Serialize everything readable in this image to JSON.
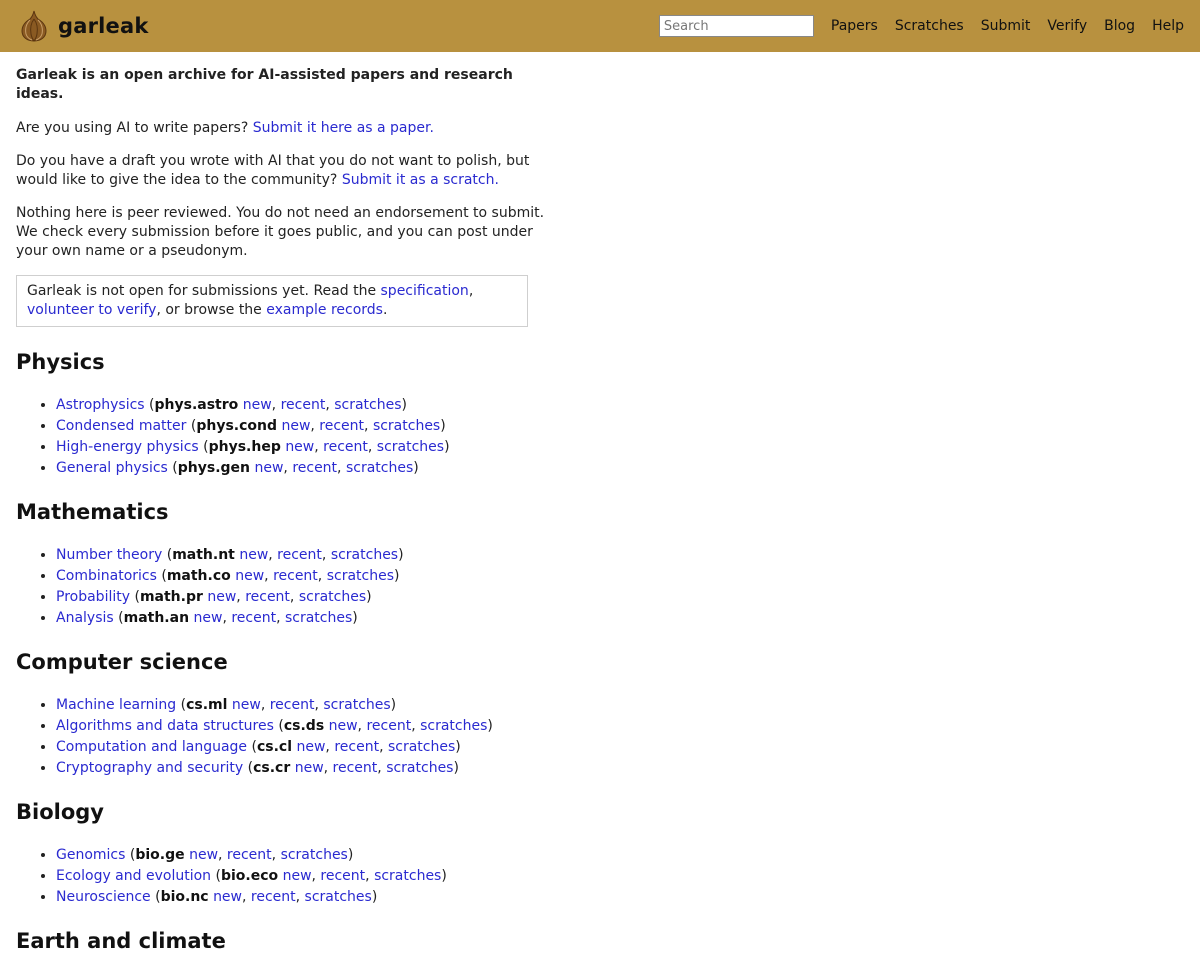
{
  "header": {
    "brand": "garleak",
    "search_placeholder": "Search",
    "nav": [
      "Papers",
      "Scratches",
      "Submit",
      "Verify",
      "Blog",
      "Help"
    ]
  },
  "intro": {
    "lede": "Garleak is an open archive for AI-assisted papers and research ideas.",
    "q1_text": "Are you using AI to write papers? ",
    "q1_link": "Submit it here as a paper.",
    "q2_text": "Do you have a draft you wrote with AI that you do not want to polish, but would like to give the idea to the community? ",
    "q2_link": "Submit it as a scratch.",
    "p3": "Nothing here is peer reviewed. You do not need an endorsement to submit. We check every submission before it goes public, and you can post under your own name or a pseudonym."
  },
  "notice": {
    "t1": "Garleak is not open for submissions yet. Read the ",
    "l1": "specification",
    "t2": ", ",
    "l2": "volunteer to verify",
    "t3": ", or browse the ",
    "l3": "example records",
    "t4": "."
  },
  "link_labels": {
    "new": "new",
    "recent": "recent",
    "scratches": "scratches"
  },
  "sections": [
    {
      "title": "Physics",
      "items": [
        {
          "name": "Astrophysics",
          "code": "phys.astro"
        },
        {
          "name": "Condensed matter",
          "code": "phys.cond"
        },
        {
          "name": "High-energy physics",
          "code": "phys.hep"
        },
        {
          "name": "General physics",
          "code": "phys.gen"
        }
      ]
    },
    {
      "title": "Mathematics",
      "items": [
        {
          "name": "Number theory",
          "code": "math.nt"
        },
        {
          "name": "Combinatorics",
          "code": "math.co"
        },
        {
          "name": "Probability",
          "code": "math.pr"
        },
        {
          "name": "Analysis",
          "code": "math.an"
        }
      ]
    },
    {
      "title": "Computer science",
      "items": [
        {
          "name": "Machine learning",
          "code": "cs.ml"
        },
        {
          "name": "Algorithms and data structures",
          "code": "cs.ds"
        },
        {
          "name": "Computation and language",
          "code": "cs.cl"
        },
        {
          "name": "Cryptography and security",
          "code": "cs.cr"
        }
      ]
    },
    {
      "title": "Biology",
      "items": [
        {
          "name": "Genomics",
          "code": "bio.ge"
        },
        {
          "name": "Ecology and evolution",
          "code": "bio.eco"
        },
        {
          "name": "Neuroscience",
          "code": "bio.nc"
        }
      ]
    },
    {
      "title": "Earth and climate",
      "items": []
    }
  ],
  "colors": {
    "header_bg": "#b8913f",
    "link": "#2a2ad0",
    "text": "#222222"
  },
  "icons": {
    "logo": "garlic-icon"
  }
}
